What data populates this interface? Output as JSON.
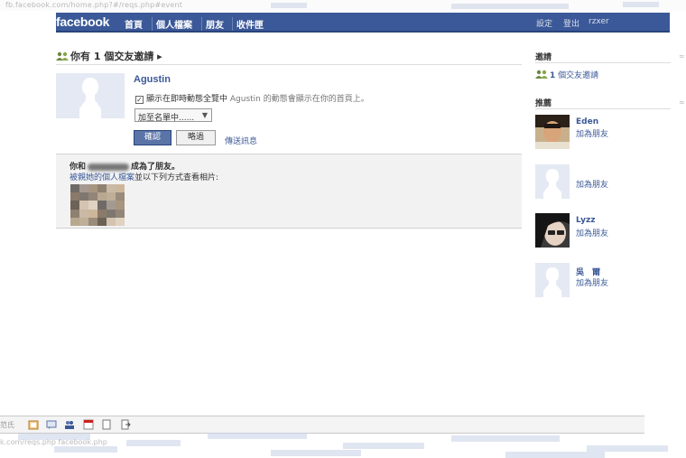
{
  "browser": {
    "url_top": "fb.facebook.com/home.php?#/reqs.php#event",
    "url_bottom": "k.com/reqs.php  facebook.php"
  },
  "topbar": {
    "logo": "facebook",
    "nav": [
      "首頁",
      "個人檔案",
      "朋友",
      "收件匣"
    ],
    "right_items": [
      "設定",
      "登出",
      "rzxer"
    ]
  },
  "request": {
    "header": "你有 1 個交友邀請 ▸",
    "name": "Agustin",
    "checkbox_label": "顯示在即時動態全覽中",
    "checkbox_checked": true,
    "checkbox_hint": "Agustin 的動態會顯示在你的首頁上。",
    "list_select": "加至名單中......",
    "confirm_label": "確認",
    "ignore_label": "略過",
    "message_link": "傳送訊息"
  },
  "friends_box": {
    "title_prefix": "你和",
    "title_suffix": "成為了朋友。",
    "subtitle_link": "被親她的個人檔案",
    "subtitle_text": "並以下列方式查看相片:"
  },
  "sidebar": {
    "invites_header": "邀請",
    "invites_link_count": "1",
    "invites_link_text": "個交友邀請",
    "suggestions_header": "推薦",
    "suggestions": [
      {
        "name": "Eden",
        "add": "加為朋友"
      },
      {
        "name": "",
        "add": "加為朋友"
      },
      {
        "name": "Lyzz",
        "add": "加為朋友"
      },
      {
        "name": "吳　爾",
        "add": "加為朋友"
      }
    ]
  },
  "taskbar": {
    "label": "范氏",
    "icons": [
      "applications-icon",
      "notifications-icon",
      "friends-icon",
      "calendar-icon",
      "notes-icon",
      "exit-icon"
    ]
  },
  "colors": {
    "brand": "#3b5998",
    "link": "#3b5998",
    "box_bg": "#f2f2f2"
  }
}
